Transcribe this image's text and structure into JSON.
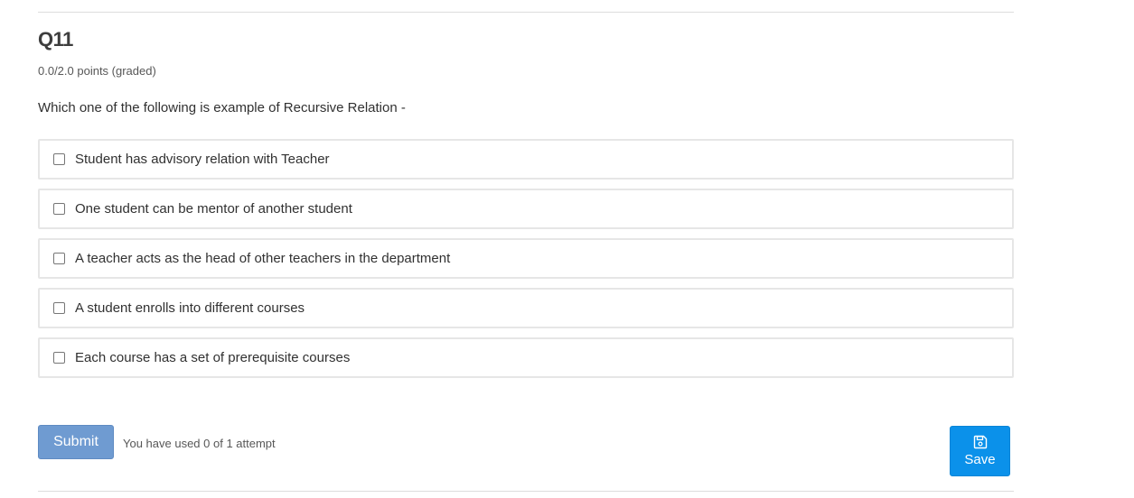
{
  "question": {
    "title": "Q11",
    "points": "0.0/2.0 points (graded)",
    "prompt": "Which one of the following is example of Recursive Relation -",
    "choices": [
      {
        "label": "Student has advisory relation with Teacher",
        "checked": false
      },
      {
        "label": "One student can be mentor of another student",
        "checked": false
      },
      {
        "label": "A teacher acts as the head of other teachers in the department",
        "checked": false
      },
      {
        "label": "A student enrolls into different courses",
        "checked": false
      },
      {
        "label": "Each course has a set of prerequisite courses",
        "checked": false
      }
    ]
  },
  "actions": {
    "submit_label": "Submit",
    "attempts_text": "You have used 0 of 1 attempt",
    "save_label": "Save",
    "save_icon": "floppy-disk-icon"
  },
  "colors": {
    "submit_bg": "#6f9bd1",
    "save_bg": "#0b91ea",
    "choice_border": "#e6e6e6"
  }
}
